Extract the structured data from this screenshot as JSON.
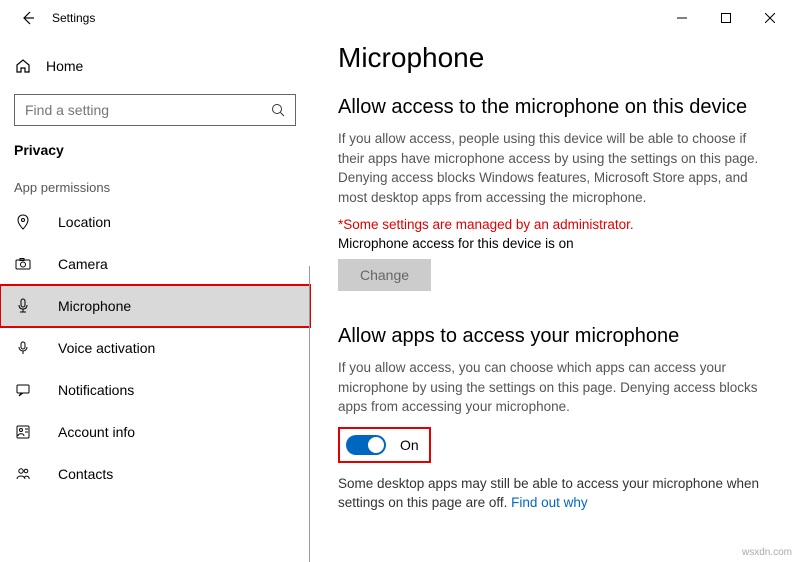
{
  "window": {
    "title": "Settings"
  },
  "sidebar": {
    "home_label": "Home",
    "search_placeholder": "Find a setting",
    "category_label": "Privacy",
    "group_label": "App permissions",
    "items": [
      {
        "label": "Location"
      },
      {
        "label": "Camera"
      },
      {
        "label": "Microphone"
      },
      {
        "label": "Voice activation"
      },
      {
        "label": "Notifications"
      },
      {
        "label": "Account info"
      },
      {
        "label": "Contacts"
      }
    ]
  },
  "main": {
    "title": "Microphone",
    "section1_heading": "Allow access to the microphone on this device",
    "section1_desc": "If you allow access, people using this device will be able to choose if their apps have microphone access by using the settings on this page. Denying access blocks Windows features, Microsoft Store apps, and most desktop apps from accessing the microphone.",
    "admin_warning": "*Some settings are managed by an administrator.",
    "device_status": "Microphone access for this device is on",
    "change_label": "Change",
    "section2_heading": "Allow apps to access your microphone",
    "section2_desc": "If you allow access, you can choose which apps can access your microphone by using the settings on this page. Denying access blocks apps from accessing your microphone.",
    "toggle_state": "On",
    "footnote_text": "Some desktop apps may still be able to access your microphone when settings on this page are off. ",
    "footnote_link": "Find out why"
  },
  "watermark": "wsxdn.com"
}
